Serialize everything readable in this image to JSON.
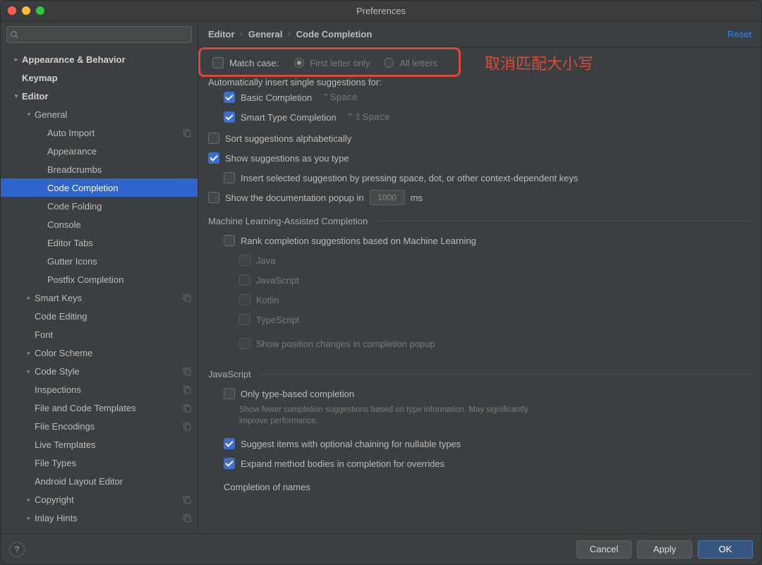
{
  "window": {
    "title": "Preferences"
  },
  "search": {
    "placeholder": ""
  },
  "sidebar": {
    "items": [
      {
        "label": "Appearance & Behavior",
        "indent": 0,
        "arrow": "right",
        "bold": true
      },
      {
        "label": "Keymap",
        "indent": 0,
        "arrow": "",
        "bold": true
      },
      {
        "label": "Editor",
        "indent": 0,
        "arrow": "down",
        "bold": true
      },
      {
        "label": "General",
        "indent": 1,
        "arrow": "down",
        "bold": false
      },
      {
        "label": "Auto Import",
        "indent": 2,
        "arrow": "",
        "copy": true
      },
      {
        "label": "Appearance",
        "indent": 2,
        "arrow": ""
      },
      {
        "label": "Breadcrumbs",
        "indent": 2,
        "arrow": ""
      },
      {
        "label": "Code Completion",
        "indent": 2,
        "arrow": "",
        "selected": true
      },
      {
        "label": "Code Folding",
        "indent": 2,
        "arrow": ""
      },
      {
        "label": "Console",
        "indent": 2,
        "arrow": ""
      },
      {
        "label": "Editor Tabs",
        "indent": 2,
        "arrow": ""
      },
      {
        "label": "Gutter Icons",
        "indent": 2,
        "arrow": ""
      },
      {
        "label": "Postfix Completion",
        "indent": 2,
        "arrow": ""
      },
      {
        "label": "Smart Keys",
        "indent": 1,
        "arrow": "right",
        "copy": true
      },
      {
        "label": "Code Editing",
        "indent": 1,
        "arrow": ""
      },
      {
        "label": "Font",
        "indent": 1,
        "arrow": ""
      },
      {
        "label": "Color Scheme",
        "indent": 1,
        "arrow": "right"
      },
      {
        "label": "Code Style",
        "indent": 1,
        "arrow": "right",
        "copy": true
      },
      {
        "label": "Inspections",
        "indent": 1,
        "arrow": "",
        "copy": true
      },
      {
        "label": "File and Code Templates",
        "indent": 1,
        "arrow": "",
        "copy": true
      },
      {
        "label": "File Encodings",
        "indent": 1,
        "arrow": "",
        "copy": true
      },
      {
        "label": "Live Templates",
        "indent": 1,
        "arrow": ""
      },
      {
        "label": "File Types",
        "indent": 1,
        "arrow": ""
      },
      {
        "label": "Android Layout Editor",
        "indent": 1,
        "arrow": ""
      },
      {
        "label": "Copyright",
        "indent": 1,
        "arrow": "right",
        "copy": true
      },
      {
        "label": "Inlay Hints",
        "indent": 1,
        "arrow": "right",
        "copy": true
      }
    ]
  },
  "breadcrumbs": {
    "a": "Editor",
    "b": "General",
    "c": "Code Completion"
  },
  "reset": "Reset",
  "callout": "取消匹配大小写",
  "opts": {
    "match_case": "Match case:",
    "first_letter": "First letter only",
    "all_letters": "All letters",
    "auto_insert": "Automatically insert single suggestions for:",
    "basic": "Basic Completion",
    "basic_sc": "⌃Space",
    "smart": "Smart Type Completion",
    "smart_sc": "⌃⇧Space",
    "sort_alpha": "Sort suggestions alphabetically",
    "show_type": "Show suggestions as you type",
    "insert_selected": "Insert selected suggestion by pressing space, dot, or other context-dependent keys",
    "show_doc": "Show the documentation popup in",
    "doc_ms": "1000",
    "ms": "ms",
    "ml_title": "Machine Learning-Assisted Completion",
    "rank_ml": "Rank completion suggestions based on Machine Learning",
    "java": "Java",
    "javascript": "JavaScript",
    "kotlin": "Kotlin",
    "typescript": "TypeScript",
    "show_pos": "Show position changes in completion popup",
    "js_title": "JavaScript",
    "only_type": "Only type-based completion",
    "only_type_hint": "Show fewer completion suggestions based on type information. May significantly improve performance.",
    "suggest_chain": "Suggest items with optional chaining for nullable types",
    "expand_bodies": "Expand method bodies in completion for overrides",
    "completion_names": "Completion of names"
  },
  "buttons": {
    "help": "?",
    "cancel": "Cancel",
    "apply": "Apply",
    "ok": "OK"
  }
}
